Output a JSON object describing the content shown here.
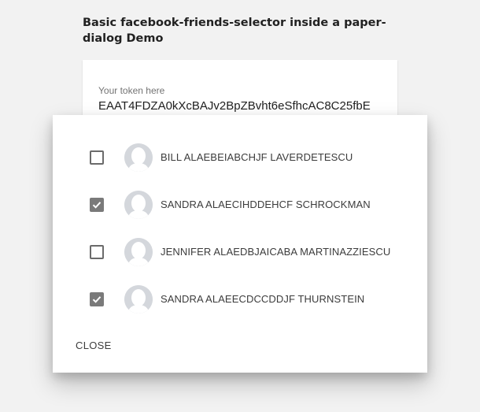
{
  "demo": {
    "title": "Basic facebook-friends-selector inside a paper-dialog Demo"
  },
  "token": {
    "label": "Your token here",
    "value": "EAAT4FDZA0kXcBAJv2BpZBvht6eSfhcAC8C25fbE"
  },
  "dialog": {
    "friends": [
      {
        "name": "BILL ALAEBEIABCHJF LAVERDETESCU",
        "checked": false,
        "avatar_icon": "person-silhouette-icon"
      },
      {
        "name": "SANDRA ALAECIHDDEHCF SCHROCKMAN",
        "checked": true,
        "avatar_icon": "person-silhouette-icon"
      },
      {
        "name": "JENNIFER ALAEDBJAICABA MARTINAZZIESCU",
        "checked": false,
        "avatar_icon": "person-silhouette-icon"
      },
      {
        "name": "SANDRA ALAEECDCCDDJF THURNSTEIN",
        "checked": true,
        "avatar_icon": "person-silhouette-icon"
      }
    ],
    "close_label": "CLOSE"
  },
  "colors": {
    "background": "#f2f2f2",
    "checkbox_checked": "#7a7a7a",
    "avatar": "#d4d7dc"
  }
}
